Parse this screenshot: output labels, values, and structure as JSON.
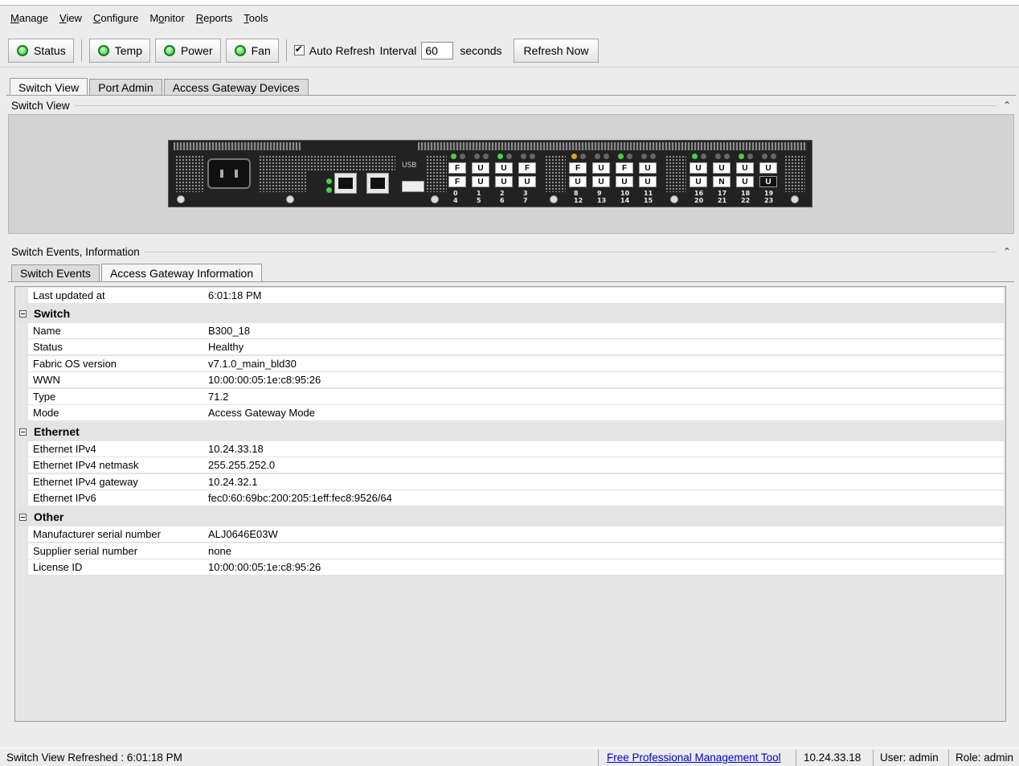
{
  "menu": [
    {
      "label": "Manage",
      "mnemonic": "M",
      "rest": "anage"
    },
    {
      "label": "View",
      "mnemonic": "V",
      "rest": "iew"
    },
    {
      "label": "Configure",
      "mnemonic": "C",
      "rest": "onfigure"
    },
    {
      "label": "Monitor",
      "pre": "M",
      "mnemonic": "o",
      "rest": "nitor"
    },
    {
      "label": "Reports",
      "mnemonic": "R",
      "rest": "eports"
    },
    {
      "label": "Tools",
      "mnemonic": "T",
      "rest": "ools"
    }
  ],
  "toolbar": {
    "status_label": "Status",
    "temp_label": "Temp",
    "power_label": "Power",
    "fan_label": "Fan",
    "auto_refresh_label": "Auto Refresh",
    "auto_refresh_checked": true,
    "interval_label": "Interval",
    "interval_value": "60",
    "seconds_label": "seconds",
    "refresh_now_label": "Refresh Now"
  },
  "main_tabs": [
    "Switch View",
    "Port Admin",
    "Access Gateway Devices"
  ],
  "switch_view_title": "Switch View",
  "switch_graphic": {
    "usb_label": "USB",
    "ports_top": [
      {
        "group": [
          {
            "n": "0",
            "b": "4",
            "t": "F",
            "bt": "F"
          },
          {
            "n": "1",
            "b": "5",
            "t": "U",
            "bt": "U"
          },
          {
            "n": "2",
            "b": "6",
            "t": "U",
            "bt": "U"
          },
          {
            "n": "3",
            "b": "7",
            "t": "F",
            "bt": "U"
          }
        ]
      },
      {
        "group": [
          {
            "n": "8",
            "b": "12",
            "t": "F",
            "bt": "U"
          },
          {
            "n": "9",
            "b": "13",
            "t": "U",
            "bt": "U"
          },
          {
            "n": "10",
            "b": "14",
            "t": "F",
            "bt": "U"
          },
          {
            "n": "11",
            "b": "15",
            "t": "U",
            "bt": "U"
          }
        ]
      },
      {
        "group": [
          {
            "n": "16",
            "b": "20",
            "t": "U",
            "bt": "U"
          },
          {
            "n": "17",
            "b": "21",
            "t": "U",
            "bt": "N"
          },
          {
            "n": "18",
            "b": "22",
            "t": "U",
            "bt": "U"
          },
          {
            "n": "19",
            "b": "23",
            "t": "U",
            "bt": "U"
          }
        ]
      }
    ]
  },
  "events_title": "Switch Events, Information",
  "sub_tabs": [
    "Switch Events",
    "Access Gateway Information"
  ],
  "info": {
    "last_updated_label": "Last updated at",
    "last_updated_value": "6:01:18 PM",
    "groups": [
      {
        "title": "Switch",
        "rows": [
          {
            "k": "Name",
            "v": "B300_18"
          },
          {
            "k": "Status",
            "v": "Healthy"
          },
          {
            "k": "Fabric OS version",
            "v": "v7.1.0_main_bld30"
          },
          {
            "k": "WWN",
            "v": "10:00:00:05:1e:c8:95:26"
          },
          {
            "k": "Type",
            "v": "71.2"
          },
          {
            "k": "Mode",
            "v": "Access Gateway Mode"
          }
        ]
      },
      {
        "title": "Ethernet",
        "rows": [
          {
            "k": "Ethernet IPv4",
            "v": "10.24.33.18"
          },
          {
            "k": "Ethernet IPv4 netmask",
            "v": "255.255.252.0"
          },
          {
            "k": "Ethernet IPv4 gateway",
            "v": "10.24.32.1"
          },
          {
            "k": "Ethernet IPv6",
            "v": "fec0:60:69bc:200:205:1eff:fec8:9526/64"
          }
        ]
      },
      {
        "title": "Other",
        "rows": [
          {
            "k": "Manufacturer serial number",
            "v": "ALJ0646E03W"
          },
          {
            "k": "Supplier serial number",
            "v": "none"
          },
          {
            "k": "License ID",
            "v": "10:00:00:05:1e:c8:95:26"
          }
        ]
      }
    ]
  },
  "statusbar": {
    "left": "Switch View Refreshed : 6:01:18 PM",
    "link": "Free Professional Management Tool",
    "ip": "10.24.33.18",
    "user": "User: admin",
    "role": "Role: admin"
  },
  "icons": {
    "led": "green-status-led-icon",
    "collapse": "double-chevron-up-icon",
    "group_toggle": "minus-box-icon"
  },
  "colors": {
    "led_green": "#6fe26f",
    "link_blue": "#0000cc",
    "background": "#ececec"
  }
}
